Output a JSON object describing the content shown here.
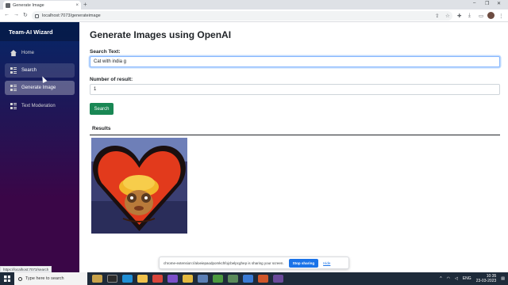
{
  "browser": {
    "tab_title": "Generate Image",
    "tab_close": "×",
    "new_tab": "+",
    "url": "localhost:7073/generateimage",
    "window_controls": [
      "–",
      "❐",
      "✕"
    ]
  },
  "sidebar": {
    "brand": "Team-AI Wizard",
    "items": [
      {
        "label": "Home",
        "icon": "home-icon"
      },
      {
        "label": "Search",
        "icon": "dashboard-icon"
      },
      {
        "label": "Generate Image",
        "icon": "dashboard-icon"
      },
      {
        "label": "Text Moderation",
        "icon": "dashboard-icon"
      }
    ]
  },
  "main": {
    "title": "Generate Images using OpenAI",
    "search_label": "Search Text:",
    "search_value": "Cat with india g",
    "count_label": "Number of result:",
    "count_value": "1",
    "search_button": "Search",
    "results_heading": "Results"
  },
  "share_banner": {
    "message": "chrome-extension://aloeiepaodpomkchfojcbelpcghep is sharing your screen.",
    "stop_label": "Stop sharing",
    "hide_label": "Hide"
  },
  "status_url": "https://localhost:7073/search",
  "taskbar": {
    "search_placeholder": "Type here to search",
    "lang": "ENG",
    "time": "10:35",
    "date": "23-03-2023"
  },
  "colors": {
    "sidebar_top": "#052767",
    "sidebar_bottom": "#3a0647",
    "search_button": "#198754",
    "focus_border": "#86b7fe"
  }
}
